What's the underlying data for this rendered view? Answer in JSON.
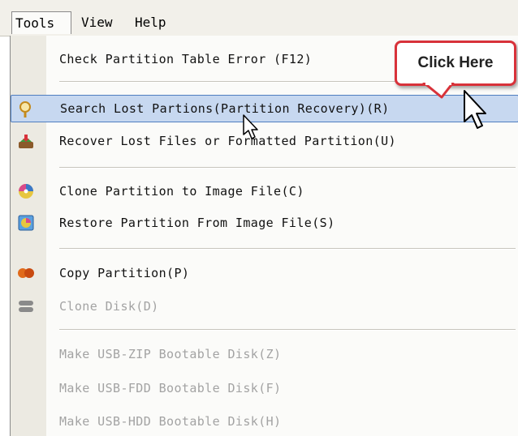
{
  "menubar": {
    "items": [
      {
        "label": "Tools"
      },
      {
        "label": "View"
      },
      {
        "label": "Help"
      }
    ]
  },
  "dropdown": {
    "items": [
      {
        "label": "Check Partition Table Error (F12)",
        "enabled": true,
        "icon": "none"
      },
      {
        "label": "Search Lost Partions(Partition Recovery)(R)",
        "enabled": true,
        "highlighted": true,
        "icon": "magnifier-icon"
      },
      {
        "label": "Recover Lost Files or Formatted Partition(U)",
        "enabled": true,
        "icon": "recover-files-icon"
      },
      {
        "label": "Clone Partition to Image File(C)",
        "enabled": true,
        "icon": "clone-partition-icon"
      },
      {
        "label": "Restore Partition From Image File(S)",
        "enabled": true,
        "icon": "restore-partition-icon"
      },
      {
        "label": "Copy Partition(P)",
        "enabled": true,
        "icon": "copy-partition-icon"
      },
      {
        "label": "Clone Disk(D)",
        "enabled": false,
        "icon": "clone-disk-icon"
      },
      {
        "label": "Make USB-ZIP Bootable Disk(Z)",
        "enabled": false,
        "icon": "none"
      },
      {
        "label": "Make USB-FDD Bootable Disk(F)",
        "enabled": false,
        "icon": "none"
      },
      {
        "label": "Make USB-HDD Bootable Disk(H)",
        "enabled": false,
        "icon": "none"
      }
    ]
  },
  "callout": {
    "text": "Click Here"
  },
  "colors": {
    "highlight_bg": "#c7d8f0",
    "highlight_border": "#4f7ec0",
    "callout_border": "#d8323a",
    "disabled_text": "#a3a3a3"
  }
}
